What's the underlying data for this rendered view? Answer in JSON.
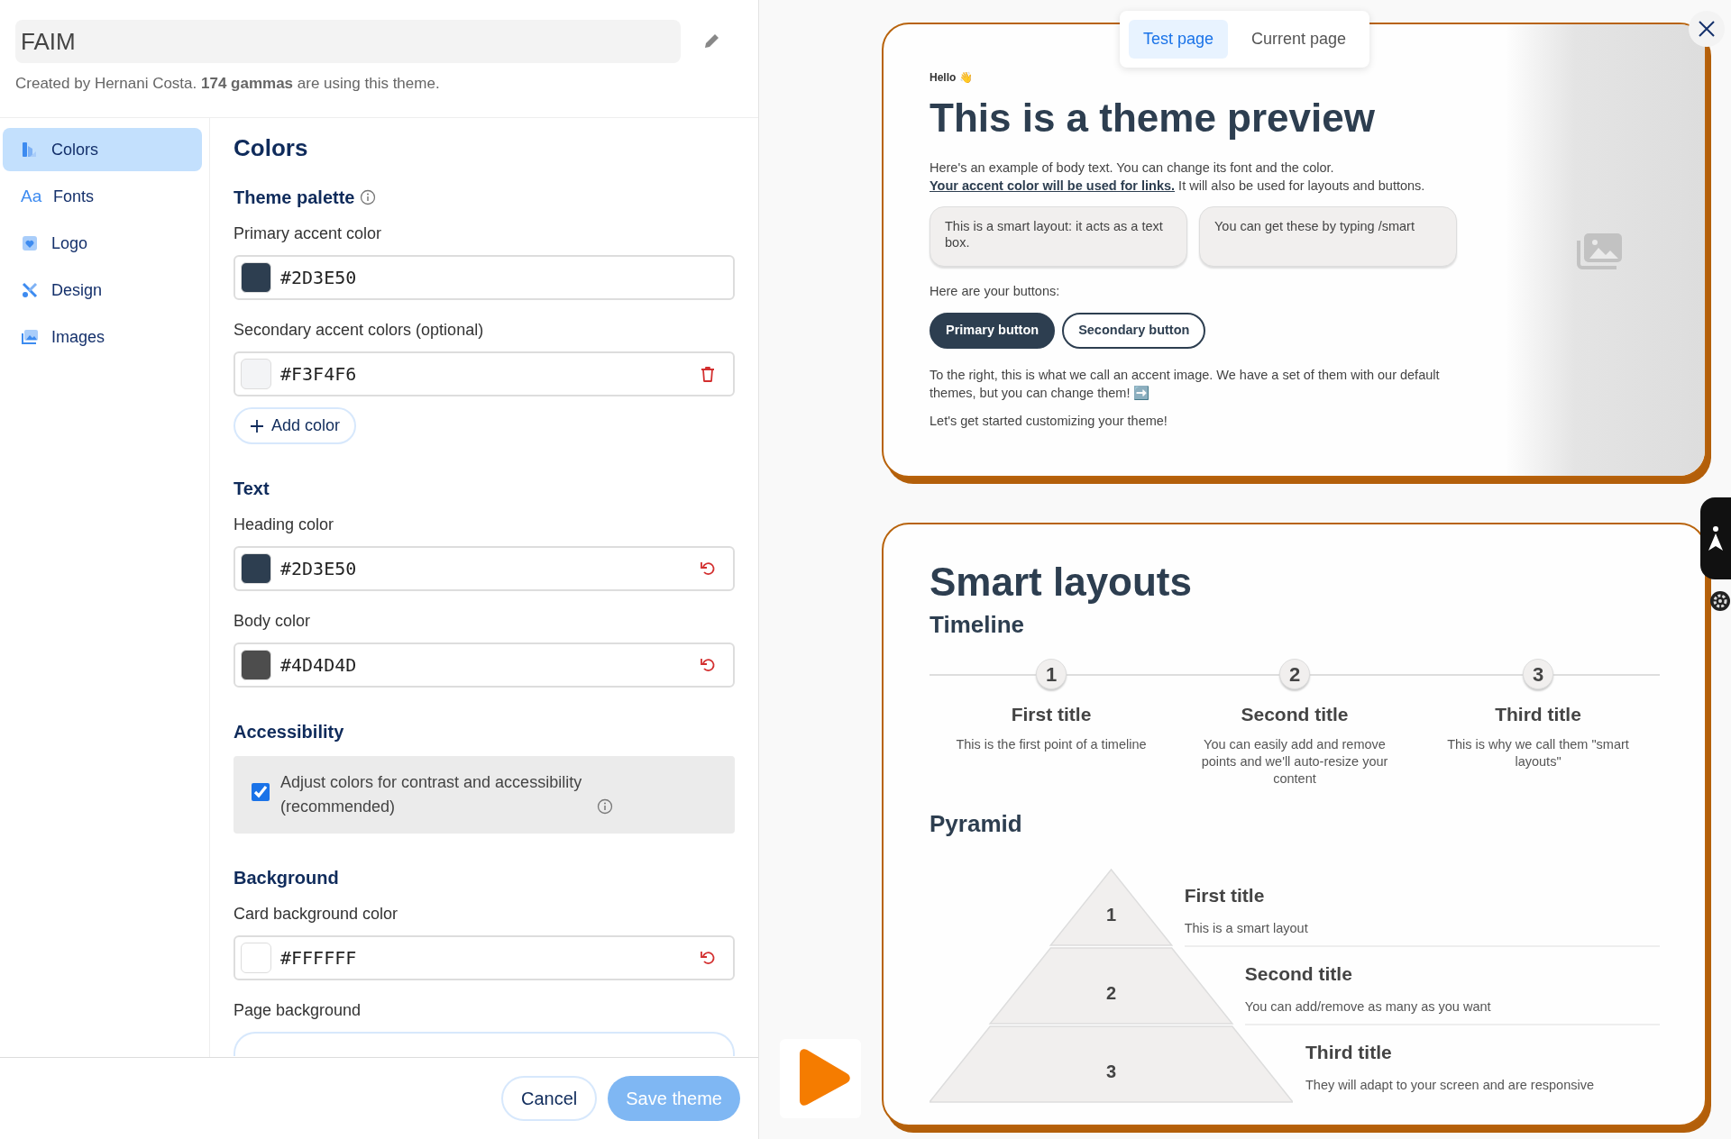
{
  "theme": {
    "name": "FAIM",
    "credit": "Created by Hernani Costa. **174 gammas** are using this theme."
  },
  "sidebar": {
    "items": [
      {
        "label": "Colors",
        "selected": true
      },
      {
        "label": "Fonts",
        "glyph": "Aa",
        "selected": false
      },
      {
        "label": "Logo",
        "selected": false
      },
      {
        "label": "Design",
        "selected": false
      },
      {
        "label": "Images",
        "selected": false
      }
    ]
  },
  "panel": {
    "title": "Colors",
    "sections": [
      {
        "heading": "Theme palette",
        "info": true,
        "fields": [
          {
            "kind": "color",
            "label": "Primary accent color",
            "value": "#2D3E50",
            "color": "#2d3e50"
          },
          {
            "kind": "color",
            "label": "Secondary accent colors (optional)",
            "value": "#F3F4F6",
            "color": "#f3f4f6",
            "removable": true
          }
        ],
        "add_button": "Add color"
      },
      {
        "heading": "Text",
        "fields": [
          {
            "kind": "color",
            "label": "Heading color",
            "value": "#2D3E50",
            "color": "#2d3e50",
            "resettable": true
          },
          {
            "kind": "color",
            "label": "Body color",
            "value": "#4D4D4D",
            "color": "#4d4d4d",
            "resettable": true
          }
        ]
      },
      {
        "heading": "Accessibility",
        "fields": [
          {
            "kind": "checkbox",
            "label": "Adjust colors for contrast and accessibility (recommended)",
            "checked": true,
            "info": true
          }
        ]
      },
      {
        "heading": "Background",
        "fields": [
          {
            "kind": "color",
            "label": "Card background color",
            "value": "#FFFFFF",
            "color": "#ffffff",
            "resettable": true
          },
          {
            "kind": "select",
            "label": "Page background"
          }
        ]
      }
    ]
  },
  "footer": {
    "buttons": [
      {
        "label": "Cancel",
        "kind": "secondary",
        "disabled": false
      },
      {
        "label": "Save theme",
        "kind": "primary",
        "disabled": true
      }
    ]
  },
  "preview": {
    "tabs": [
      {
        "label": "Test page",
        "selected": true
      },
      {
        "label": "Current page",
        "selected": false
      }
    ],
    "intro_card": {
      "greeting": "Hello 👋",
      "title": "This is a theme preview",
      "body": {
        "before": "Here's an example of body text. You can change its font and the color. ",
        "link": "Your accent color will be used for links.",
        "after": " It will also be used for layouts and buttons."
      },
      "boxes": [
        "This is a smart layout: it acts as a text box.",
        "You can get these by typing /smart"
      ],
      "buttons_intro": "Here are your buttons:",
      "buttons": [
        {
          "label": "Primary button",
          "kind": "primary"
        },
        {
          "label": "Secondary button",
          "kind": "secondary"
        }
      ],
      "paragraphs": [
        "To the right, this is what we call an accent image. We have a set of them with our default themes, but you can change them! ➡️",
        "Let's get started customizing your theme!"
      ]
    },
    "layouts_card": {
      "title": "Smart layouts",
      "timeline_heading": "Timeline",
      "timeline": [
        {
          "number": "1",
          "title": "First title",
          "text": "This is the first point of a timeline"
        },
        {
          "number": "2",
          "title": "Second title",
          "text": "You can easily add and remove points and we'll auto-resize your content"
        },
        {
          "number": "3",
          "title": "Third title",
          "text": "This is why we call them \"smart layouts\""
        }
      ],
      "pyramid_heading": "Pyramid",
      "pyramid": [
        {
          "number": "1",
          "title": "First title",
          "text": "This is a smart layout"
        },
        {
          "number": "2",
          "title": "Second title",
          "text": "You can add/remove as many as you want"
        },
        {
          "number": "3",
          "title": "Third title",
          "text": "They will adapt to your screen and are responsive"
        }
      ]
    }
  }
}
